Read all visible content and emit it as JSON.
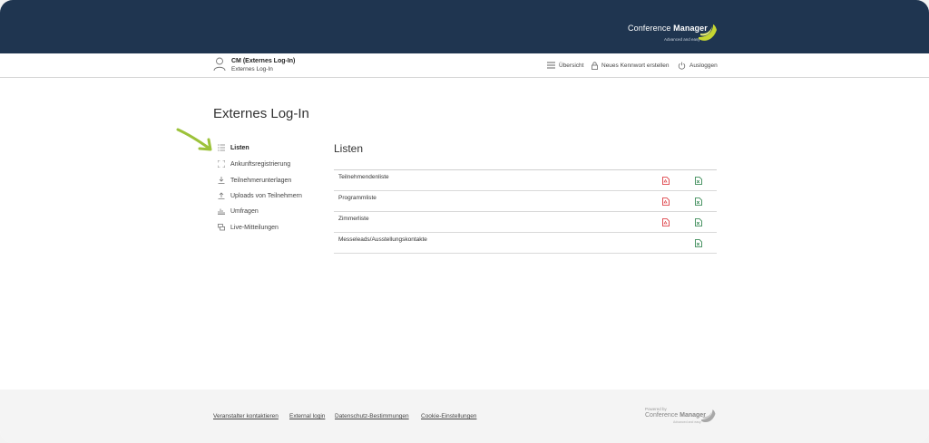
{
  "header": {
    "brand_light": "Conference ",
    "brand_bold": "Manager",
    "tagline": "Advanced and easy",
    "accent": "#c6d631",
    "background": "#1f3550"
  },
  "user": {
    "name": "CM (Externes Log-In)",
    "role": "Externes Log-In"
  },
  "topnav": [
    {
      "label": "Übersicht",
      "icon": "list-icon"
    },
    {
      "label": "Neues Kennwort erstellen",
      "icon": "lock-icon"
    },
    {
      "label": "Ausloggen",
      "icon": "power-icon"
    }
  ],
  "page_title": "Externes Log-In",
  "sidebar": {
    "items": [
      {
        "label": "Listen",
        "icon": "list-icon",
        "active": true
      },
      {
        "label": "Ankunftsregistrierung",
        "icon": "scan-icon"
      },
      {
        "label": "Teilnehmerunterlagen",
        "icon": "download-icon"
      },
      {
        "label": "Uploads von Teilnehmern",
        "icon": "upload-icon"
      },
      {
        "label": "Umfragen",
        "icon": "bar-chart-icon"
      },
      {
        "label": "Live-Mitteilungen",
        "icon": "chat-icon"
      }
    ]
  },
  "section_title": "Listen",
  "lists": [
    {
      "name": "Teilnehmendenliste",
      "pdf": true,
      "excel": true
    },
    {
      "name": "Programmliste",
      "pdf": true,
      "excel": true
    },
    {
      "name": "Zimmerliste",
      "pdf": true,
      "excel": true
    },
    {
      "name": "Messeleads/Ausstellungskontakte",
      "pdf": false,
      "excel": true
    }
  ],
  "footer": {
    "links": [
      "Veranstalter kontaktieren",
      "External login",
      "Datenschutz-Bestimmungen",
      "Cookie-Einstellungen"
    ],
    "powered_by": "Powered by",
    "brand_light": "Conference ",
    "brand_bold": "Manager",
    "tagline": "Advanced and easy"
  },
  "colors": {
    "pdf": "#d9262c",
    "excel": "#1d7a3e",
    "arrow": "#9cc23a"
  }
}
